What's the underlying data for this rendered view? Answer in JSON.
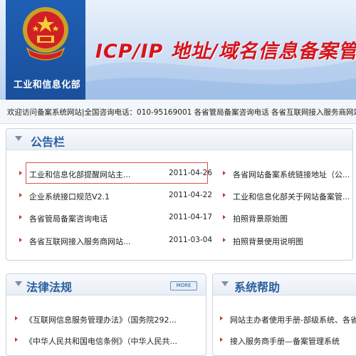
{
  "header": {
    "ministry_name": "工业和信息化部",
    "site_title": "ICP/IP 地址/域名信息备案管理系统"
  },
  "infobar": {
    "text": "欢迎访问备案系统网站|全国咨询电话：010-95169001  各省管局备案咨询电话  各省互联网接入服务商网站备案咨询电话"
  },
  "announcements": {
    "title": "公告栏",
    "left_items": [
      {
        "label": "工业和信息化部提醒网站主...",
        "date": "2011-04-26"
      },
      {
        "label": "企业系统接口规范V2.1",
        "date": "2011-04-22"
      },
      {
        "label": "各省管局备案咨询电话",
        "date": "2011-04-17"
      },
      {
        "label": "各省互联网接入服务商网站...",
        "date": "2011-03-04"
      }
    ],
    "right_items": [
      {
        "label": "各省网站备案系统链接地址（公..."
      },
      {
        "label": "工业和信息化部关于网站备案管..."
      },
      {
        "label": "拍照背景原始图"
      },
      {
        "label": "拍照背景使用说明图"
      }
    ]
  },
  "laws": {
    "title": "法律法规",
    "more_label": "MORE",
    "items": [
      {
        "label": "《互联网信息服务管理办法》（国务院292..."
      },
      {
        "label": "《中华人民共和国电信条例》（中华人民共..."
      }
    ]
  },
  "help": {
    "title": "系统帮助",
    "items": [
      {
        "label": "网站主办者使用手册-部级系统、各省局系统"
      },
      {
        "label": "接入服务商手册—备案管理系统"
      }
    ]
  }
}
